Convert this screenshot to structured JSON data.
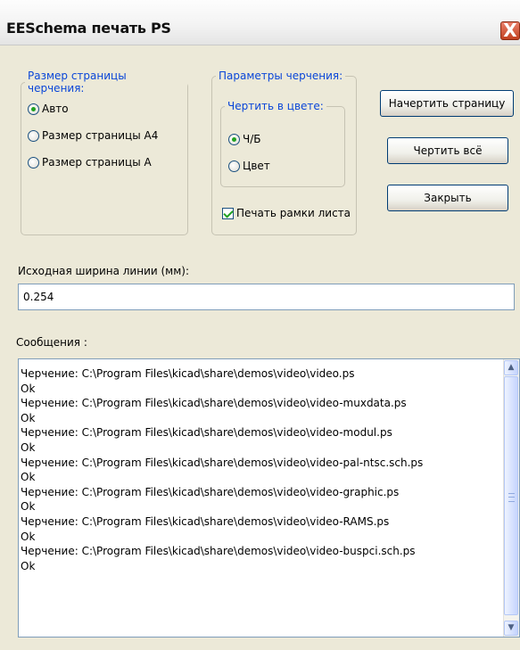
{
  "window": {
    "title": "EESchema печать PS",
    "close_glyph": "X"
  },
  "page_size": {
    "legend": "Размер страницы черчения:",
    "options": [
      "Авто",
      "Размер страницы А4",
      "Размер страницы А"
    ],
    "selected_index": 0
  },
  "plot_params": {
    "legend": "Параметры черчения:",
    "color_group": {
      "legend": "Чертить в цвете:",
      "options": [
        "Ч/Б",
        "Цвет"
      ],
      "selected_index": 0
    },
    "frame_checkbox": {
      "label": "Печать рамки листа",
      "checked": true
    }
  },
  "buttons": {
    "plot_page": "Начертить страницу",
    "plot_all": "Чертить всё",
    "close": "Закрыть"
  },
  "line_width": {
    "label": "Исходная ширина линии (мм):",
    "value": "0.254"
  },
  "messages": {
    "label": "Сообщения :",
    "lines": [
      "Черчение: C:\\Program Files\\kicad\\share\\demos\\video\\video.ps",
      "Ok",
      "Черчение: C:\\Program Files\\kicad\\share\\demos\\video\\video-muxdata.ps",
      "Ok",
      "Черчение: C:\\Program Files\\kicad\\share\\demos\\video\\video-modul.ps",
      "Ok",
      "Черчение: C:\\Program Files\\kicad\\share\\demos\\video\\video-pal-ntsc.sch.ps",
      "Ok",
      "Черчение: C:\\Program Files\\kicad\\share\\demos\\video\\video-graphic.ps",
      "Ok",
      "Черчение: C:\\Program Files\\kicad\\share\\demos\\video\\video-RAMS.ps",
      "Ok",
      "Черчение: C:\\Program Files\\kicad\\share\\demos\\video\\video-buspci.sch.ps",
      "Ok"
    ]
  },
  "icons": {
    "close": "close-icon",
    "scroll_up": "scroll-up-arrow-icon",
    "scroll_down": "scroll-down-arrow-icon"
  }
}
